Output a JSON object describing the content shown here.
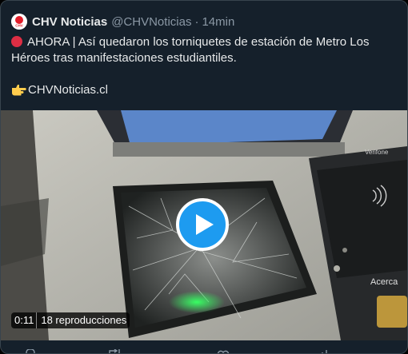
{
  "tweet": {
    "author_name": "CHV Noticias",
    "handle": "@CHVNoticias",
    "separator": "·",
    "time": "14min",
    "text_line1": "AHORA | Así quedaron los torniquetes de estación de Metro Los Héroes tras manifestaciones estudiantiles.",
    "link_text": "CHVNoticias.cl"
  },
  "avatar": {
    "label": "CHV",
    "icon": "chv-logo-icon"
  },
  "media": {
    "duration": "0:11",
    "views": "18 reproducciones",
    "scene_text_top": "Verifone",
    "scene_text_side": "Acerca",
    "play_icon": "play-icon"
  },
  "icons": {
    "red_circle": "red-circle-emoji-icon",
    "pointing": "pointing-right-emoji-icon"
  },
  "colors": {
    "background": "#15202b",
    "accent": "#1d9bf0",
    "muted": "#8b98a5",
    "text": "#e7e9ea"
  }
}
